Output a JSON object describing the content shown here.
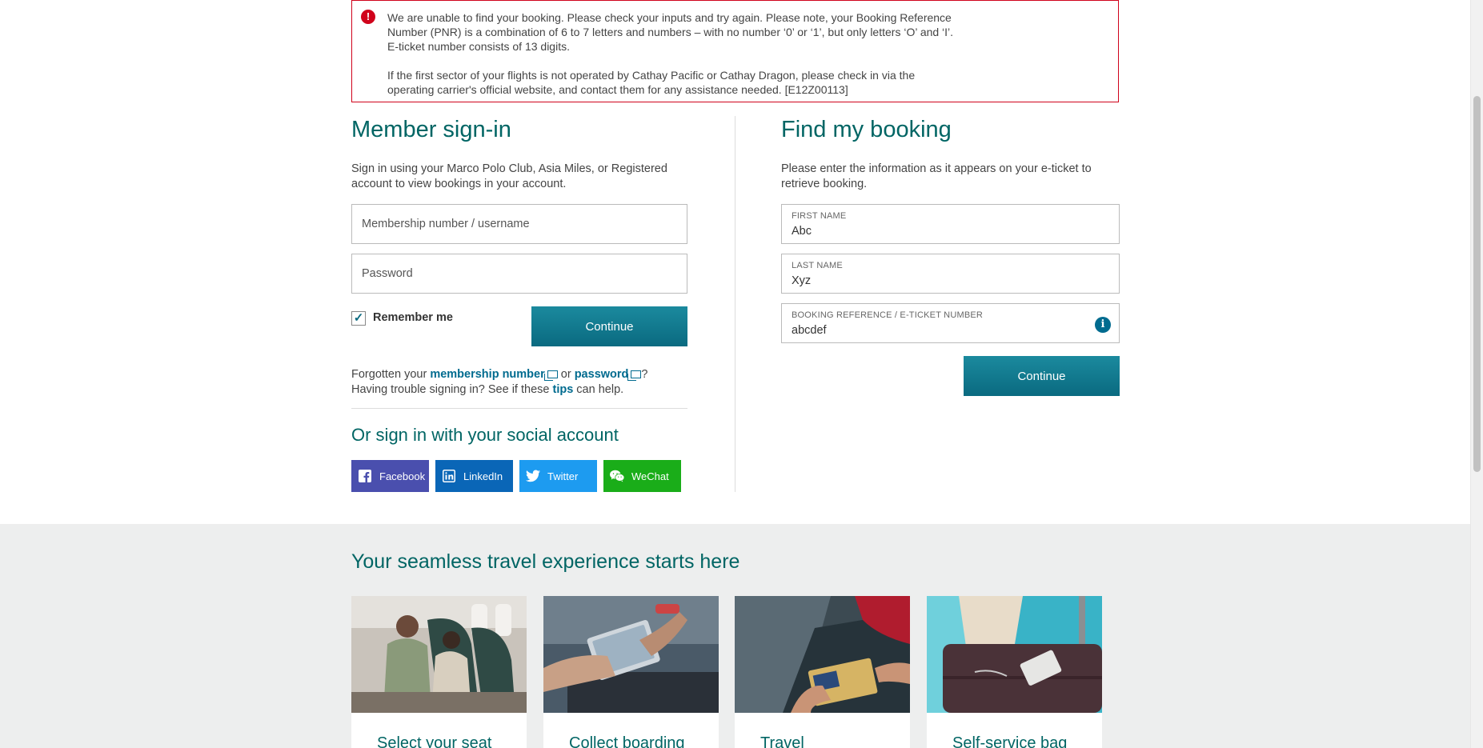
{
  "error": {
    "icon": "exclamation-icon",
    "paragraph1": "We are unable to find your booking. Please check your inputs and try again. Please note, your Booking Reference Number (PNR) is a combination of 6 to 7 letters and numbers – with no number ‘0’ or ‘1’, but only letters ‘O’ and ‘I’. E-ticket number consists of 13 digits.",
    "paragraph2": "If the first sector of your flights is not operated by Cathay Pacific or Cathay Dragon, please check in via the operating carrier's official website, and contact them for any assistance needed. [E12Z00113]"
  },
  "member_signin": {
    "title": "Member sign-in",
    "description": "Sign in using your Marco Polo Club, Asia Miles, or Registered account to view bookings in your account.",
    "username_placeholder": "Membership number / username",
    "password_placeholder": "Password",
    "remember_label": "Remember me",
    "remember_checked": true,
    "continue_label": "Continue",
    "forgot_prefix": "Forgotten your ",
    "forgot_link1": "membership number",
    "forgot_or": " or ",
    "forgot_link2": "password",
    "forgot_suffix": "?",
    "trouble_prefix": "Having trouble signing in? See if these ",
    "trouble_link": "tips",
    "trouble_suffix": " can help."
  },
  "social": {
    "title": "Or sign in with your social account",
    "buttons": [
      {
        "label": "Facebook",
        "icon": "facebook-icon",
        "color": "#4a4fae"
      },
      {
        "label": "LinkedIn",
        "icon": "linkedin-icon",
        "color": "#0a66b7"
      },
      {
        "label": "Twitter",
        "icon": "twitter-icon",
        "color": "#1d9bf0"
      },
      {
        "label": "WeChat",
        "icon": "wechat-icon",
        "color": "#1aad19"
      }
    ]
  },
  "find_booking": {
    "title": "Find my booking",
    "description": "Please enter the information as it appears on your e-ticket to retrieve booking.",
    "first_name_label": "FIRST NAME",
    "first_name_value": "Abc",
    "last_name_label": "LAST NAME",
    "last_name_value": "Xyz",
    "booking_ref_label": "BOOKING REFERENCE / E-TICKET NUMBER",
    "booking_ref_value": "abcdef",
    "continue_label": "Continue"
  },
  "experience": {
    "title": "Your seamless travel experience starts here",
    "cards": [
      {
        "caption": "Select your seat"
      },
      {
        "caption": "Collect boarding"
      },
      {
        "caption": "Travel"
      },
      {
        "caption": "Self-service bag"
      }
    ]
  },
  "colors": {
    "accent": "#006564",
    "button": "#0a6a80",
    "error": "#d0021b"
  }
}
